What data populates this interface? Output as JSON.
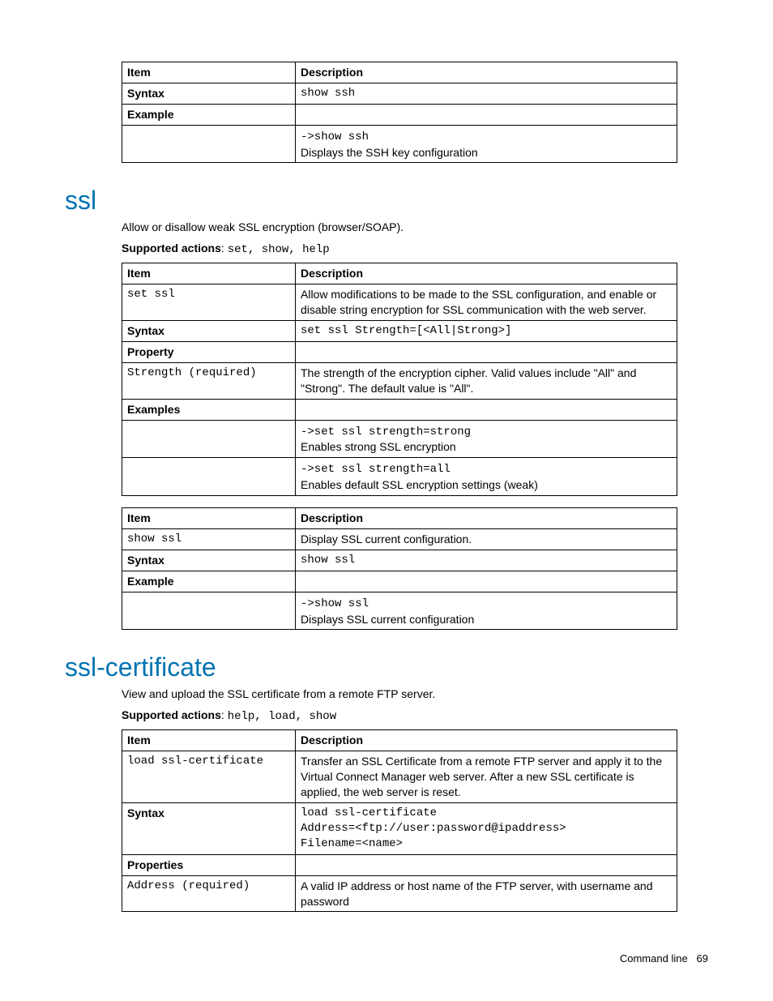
{
  "table_ssh": {
    "headers": {
      "item": "Item",
      "desc": "Description"
    },
    "rows": [
      {
        "item_label": "Syntax",
        "item_bold": true,
        "desc": "show ssh",
        "desc_mono": true
      },
      {
        "item_label": "Example",
        "item_bold": true,
        "desc": ""
      },
      {
        "item_label": "",
        "item_bold": false,
        "desc_line1": "->show ssh",
        "desc_line1_mono": true,
        "desc_line2": "Displays the SSH key configuration"
      }
    ]
  },
  "ssl": {
    "heading": "ssl",
    "intro": "Allow or disallow weak SSL encryption (browser/SOAP).",
    "supported_label": "Supported actions",
    "supported_actions": "set, show, help"
  },
  "table_ssl_set": {
    "headers": {
      "item": "Item",
      "desc": "Description"
    },
    "rows": [
      {
        "item_label": "set ssl",
        "item_mono": true,
        "desc": "Allow modifications to be made to the SSL configuration, and enable or disable string encryption for SSL communication with the web server."
      },
      {
        "item_label": "Syntax",
        "item_bold": true,
        "desc": "set ssl Strength=[<All|Strong>]",
        "desc_mono": true
      },
      {
        "item_label": "Property",
        "item_bold": true,
        "desc": ""
      },
      {
        "item_label": "Strength (required)",
        "item_mono": true,
        "desc": "The strength of the encryption cipher. Valid values include \"All\" and \"Strong\". The default value is \"All\"."
      },
      {
        "item_label": "Examples",
        "item_bold": true,
        "desc": ""
      },
      {
        "item_label": "",
        "desc_line1": "->set ssl strength=strong",
        "desc_line1_mono": true,
        "desc_line2": "Enables strong SSL encryption"
      },
      {
        "item_label": "",
        "desc_line1": "->set ssl strength=all",
        "desc_line1_mono": true,
        "desc_line2": "Enables default SSL encryption settings (weak)"
      }
    ]
  },
  "table_ssl_show": {
    "headers": {
      "item": "Item",
      "desc": "Description"
    },
    "rows": [
      {
        "item_label": "show ssl",
        "item_mono": true,
        "desc": "Display SSL current configuration."
      },
      {
        "item_label": "Syntax",
        "item_bold": true,
        "desc": "show ssl",
        "desc_mono": true
      },
      {
        "item_label": "Example",
        "item_bold": true,
        "desc": ""
      },
      {
        "item_label": "",
        "desc_line1": "->show ssl",
        "desc_line1_mono": true,
        "desc_line2": "Displays SSL current configuration"
      }
    ]
  },
  "ssl_cert": {
    "heading": "ssl-certificate",
    "intro": "View and upload the SSL certificate from a remote FTP server.",
    "supported_label": "Supported actions",
    "supported_actions": "help, load, show"
  },
  "table_ssl_cert": {
    "headers": {
      "item": "Item",
      "desc": "Description"
    },
    "rows": [
      {
        "item_label": "load ssl-certificate",
        "item_mono": true,
        "desc": "Transfer an SSL Certificate from a remote FTP server and apply it to the Virtual Connect Manager web server. After a new SSL certificate is applied, the web server is reset."
      },
      {
        "item_label": "Syntax",
        "item_bold": true,
        "desc": "load ssl-certificate\nAddress=<ftp://user:password@ipaddress>\nFilename=<name>",
        "desc_mono": true,
        "desc_pre": true
      },
      {
        "item_label": "Properties",
        "item_bold": true,
        "desc": ""
      },
      {
        "item_label": "Address (required)",
        "item_mono": true,
        "desc": "A valid IP address or host name of the FTP server, with username and password"
      }
    ]
  },
  "footer": {
    "label": "Command line",
    "page": "69"
  }
}
